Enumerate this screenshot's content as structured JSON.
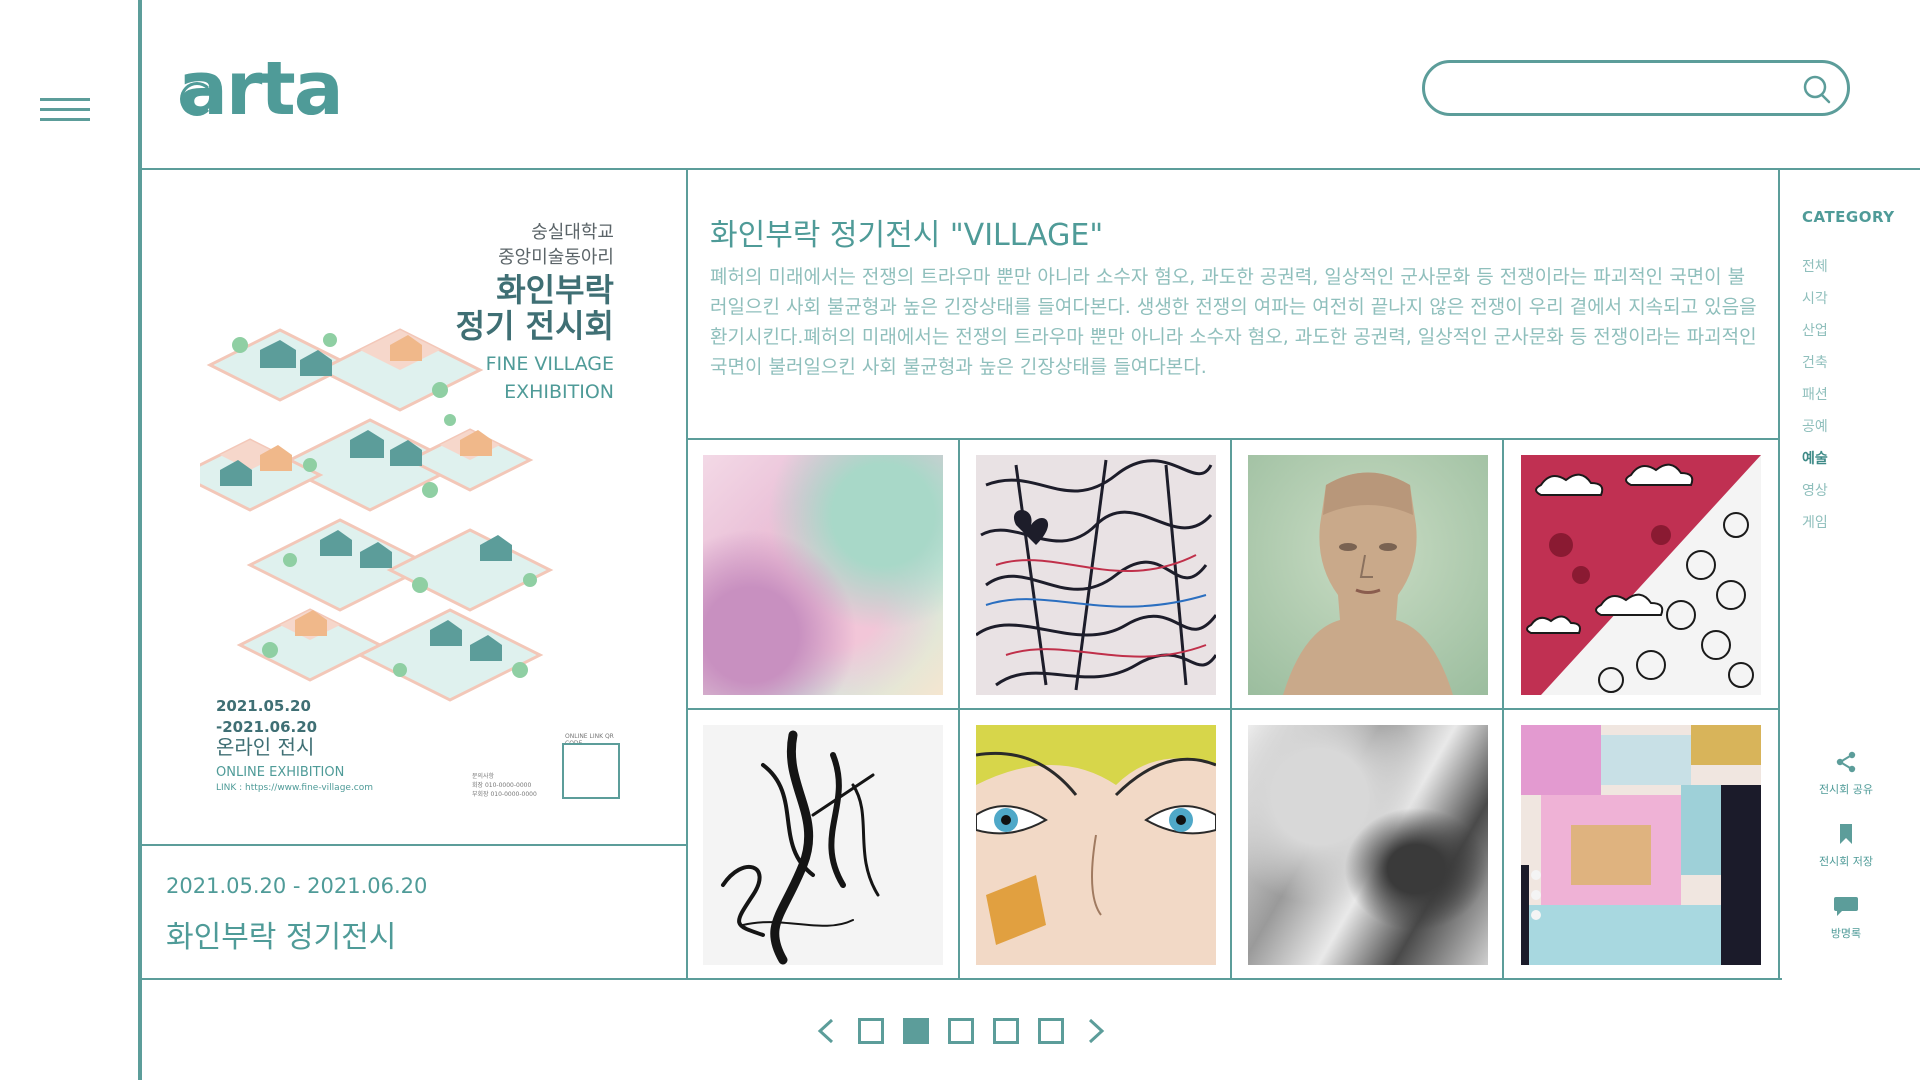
{
  "header": {
    "logo_text": "arta",
    "search": {
      "placeholder": "",
      "value": ""
    }
  },
  "poster": {
    "club_line1": "숭실대학교",
    "club_line2": "중앙미술동아리",
    "title_line1": "화인부락",
    "title_line2": "정기 전시회",
    "en_line1": "FINE VILLAGE",
    "en_line2": "EXHIBITION",
    "date_line1": "2021.05.20",
    "date_line2": "-2021.06.20",
    "online_ko": "온라인 전시",
    "online_en": "ONLINE EXHIBITION",
    "link": "LINK : https://www.fine-village.com",
    "qr_label": "ONLINE LINK QR CODE",
    "contact_title": "문의사항",
    "contact_1": "회장 010-0000-0000",
    "contact_2": "부회장 010-0000-0000"
  },
  "exhibition": {
    "date_range": "2021.05.20 - 2021.06.20",
    "title": "화인부락 정기전시",
    "heading": "화인부락 정기전시 \"VILLAGE\"",
    "description": "폐허의 미래에서는 전쟁의 트라우마 뿐만 아니라 소수자 혐오, 과도한 공권력, 일상적인 군사문화 등 전쟁이라는 파괴적인 국면이 불러일으킨 사회 불균형과 높은 긴장상태를 들여다본다. 생생한 전쟁의 여파는 여전히 끝나지 않은 전쟁이 우리 곁에서 지속되고 있음을 환기시킨다.폐허의 미래에서는 전쟁의 트라우마 뿐만 아니라 소수자 혐오, 과도한 공권력, 일상적인 군사문화 등 전쟁이라는 파괴적인 국면이 불러일으킨 사회 불균형과 높은 긴장상태를 들여다본다."
  },
  "gallery": {
    "artworks": [
      "pastel-abstract-painting",
      "graffiti-heart-doodle",
      "nefertiti-bust-photo",
      "cloud-pattern-illustration",
      "black-ink-brushstrokes",
      "pop-art-face-closeup",
      "marble-swirl-texture",
      "pink-gold-abstract-collage"
    ]
  },
  "category": {
    "title": "CATEGORY",
    "items": [
      "전체",
      "시각",
      "산업",
      "건축",
      "패션",
      "공예",
      "예술",
      "영상",
      "게임"
    ],
    "active": "예술"
  },
  "actions": {
    "share": "전시회 공유",
    "save": "전시회 저장",
    "guestbook": "방명록"
  },
  "pager": {
    "pages": 5,
    "current": 2
  },
  "colors": {
    "accent": "#5c9d9a",
    "text_light": "#8fbfbc",
    "text_main": "#4f9b98"
  }
}
